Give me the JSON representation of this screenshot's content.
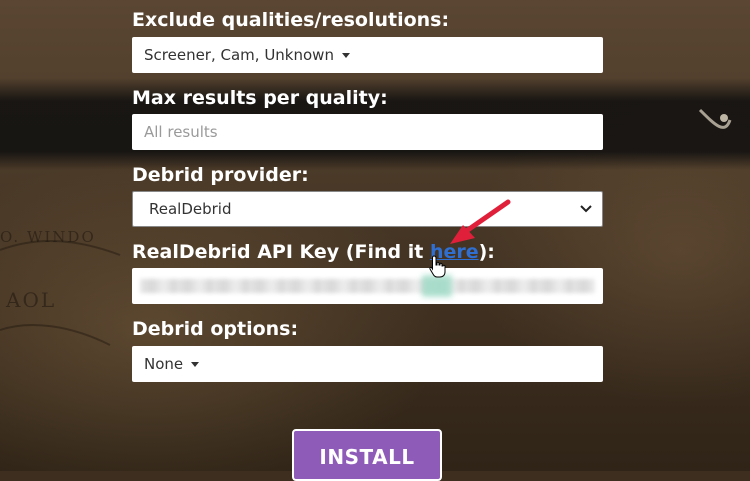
{
  "form": {
    "exclude": {
      "label": "Exclude qualities/resolutions:",
      "value": "Screener, Cam, Unknown"
    },
    "max_results": {
      "label": "Max results per quality:",
      "placeholder": "All results"
    },
    "debrid_provider": {
      "label": "Debrid provider:",
      "value": "RealDebrid"
    },
    "api_key": {
      "label_prefix": "RealDebrid API Key (Find it ",
      "link_text": "here",
      "label_suffix": "):"
    },
    "debrid_options": {
      "label": "Debrid options:",
      "value": "None"
    },
    "install_label": "INSTALL"
  },
  "background": {
    "map_words": [
      "O. WINDO",
      "AOL"
    ]
  },
  "colors": {
    "install_bg": "#8e5bb8",
    "link": "#2f6fd1",
    "arrow": "#e0203a"
  },
  "icons": [
    "caret-down-icon",
    "chevron-down-icon",
    "hand-pointer-icon",
    "red-arrow-icon"
  ]
}
